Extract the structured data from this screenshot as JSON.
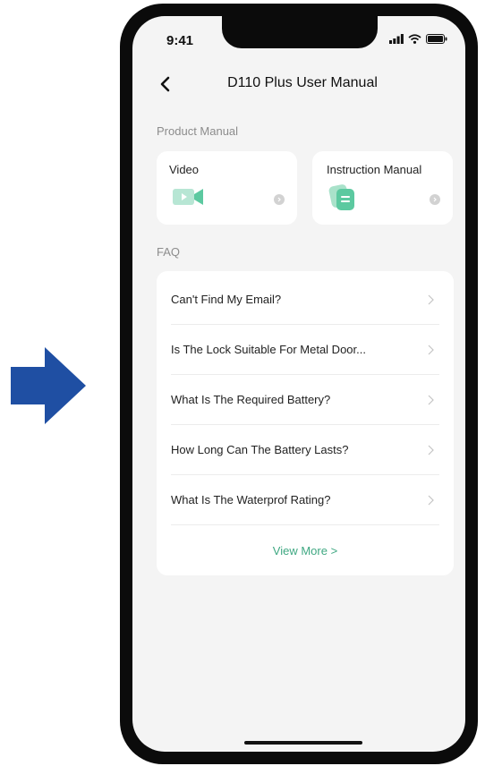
{
  "colors": {
    "arrow": "#1f4fa3",
    "accent": "#3fa882",
    "icon_green": "#5cc9a0"
  },
  "status_bar": {
    "time": "9:41",
    "icons": [
      "signal-icon",
      "wifi-icon",
      "battery-icon"
    ]
  },
  "nav": {
    "back_icon": "chevron-left-icon",
    "title": "D110 Plus User Manual"
  },
  "product_manual": {
    "label": "Product Manual",
    "cards": [
      {
        "label": "Video",
        "icon": "video-camera-icon"
      },
      {
        "label": "Instruction Manual",
        "icon": "document-icon"
      }
    ]
  },
  "faq": {
    "label": "FAQ",
    "items": [
      {
        "text": "Can't Find My Email?"
      },
      {
        "text": "Is The Lock Suitable For Metal Door..."
      },
      {
        "text": "What Is The Required Battery?"
      },
      {
        "text": "How Long Can The Battery Lasts?"
      },
      {
        "text": "What Is The Waterprof Rating?"
      }
    ],
    "view_more": "View More >"
  }
}
